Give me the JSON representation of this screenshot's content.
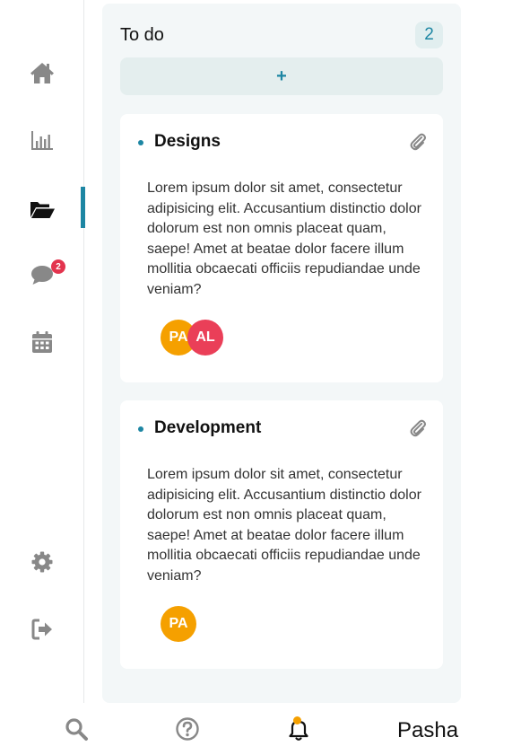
{
  "sidebar": {
    "items": [
      {
        "name": "home",
        "icon": "home-icon"
      },
      {
        "name": "stats",
        "icon": "bar-chart-icon"
      },
      {
        "name": "projects",
        "icon": "folder-open-icon",
        "active": true
      },
      {
        "name": "messages",
        "icon": "chat-icon",
        "badge": "2"
      },
      {
        "name": "calendar",
        "icon": "calendar-icon"
      },
      {
        "name": "settings",
        "icon": "gear-icon"
      },
      {
        "name": "logout",
        "icon": "sign-out-icon"
      }
    ]
  },
  "column": {
    "title": "To do",
    "count": "2",
    "add_label": "+"
  },
  "cards": [
    {
      "title": "Designs",
      "description": "Lorem ipsum dolor sit amet, consectetur adipisicing elit. Accusantium distinctio dolor dolorum est non omnis placeat quam, saepe! Amet at beatae dolor facere illum mollitia obcaecati officiis repudiandae unde veniam?",
      "avatars": [
        "PA",
        "AL"
      ]
    },
    {
      "title": "Development",
      "description": "Lorem ipsum dolor sit amet, consectetur adipisicing elit. Accusantium distinctio dolor dolorum est non omnis placeat quam, saepe! Amet at beatae dolor facere illum mollitia obcaecati officiis repudiandae unde veniam?",
      "avatars": [
        "PA"
      ]
    }
  ],
  "bottom_bar": {
    "user_name": "Pasha"
  },
  "colors": {
    "accent": "#1d86a3",
    "badge": "#e3344e",
    "avatar_pa": "#f5a000",
    "avatar_al": "#ea3f58",
    "icon_gray": "#888888"
  }
}
